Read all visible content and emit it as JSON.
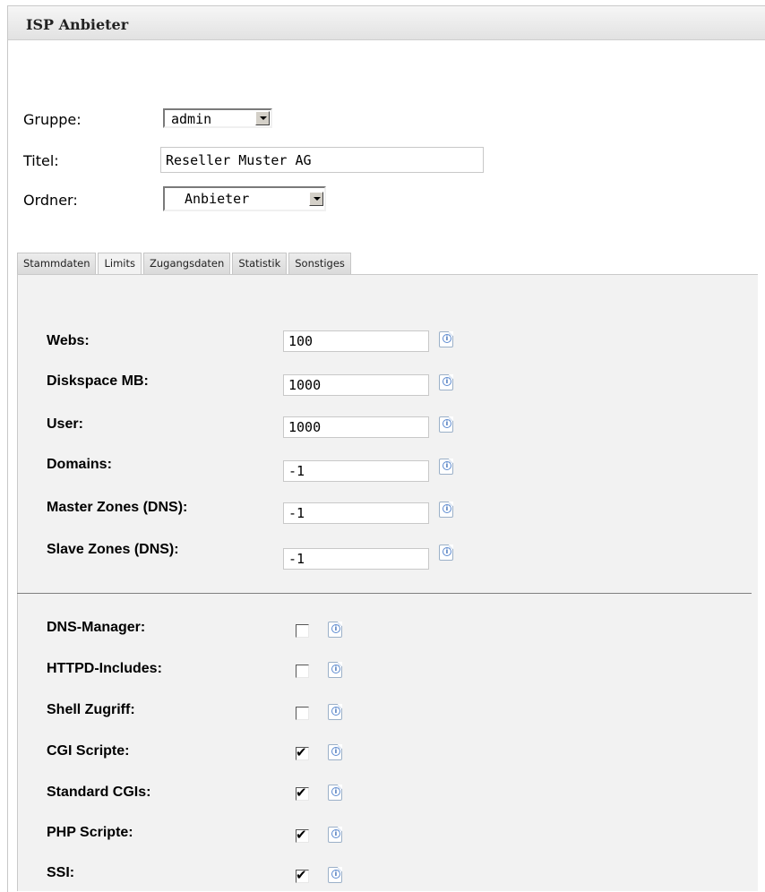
{
  "window": {
    "title": "ISP Anbieter"
  },
  "header": {
    "group_label": "Gruppe:",
    "group_value": "admin",
    "title_label": "Titel:",
    "title_value": "Reseller Muster AG",
    "folder_label": "Ordner:",
    "folder_value": "Anbieter"
  },
  "tabs": [
    {
      "label": "Stammdaten"
    },
    {
      "label": "Limits",
      "active": true
    },
    {
      "label": "Zugangsdaten"
    },
    {
      "label": "Statistik"
    },
    {
      "label": "Sonstiges"
    }
  ],
  "limits": [
    {
      "label": "Webs:",
      "value": "100"
    },
    {
      "label": "Diskspace MB:",
      "value": "1000"
    },
    {
      "label": "User:",
      "value": "1000"
    },
    {
      "label": "Domains:",
      "value": "-1"
    },
    {
      "label": "Master Zones (DNS):",
      "value": "-1"
    },
    {
      "label": "Slave Zones (DNS):",
      "value": "-1"
    }
  ],
  "options": [
    {
      "label": "DNS-Manager:",
      "checked": false
    },
    {
      "label": "HTTPD-Includes:",
      "checked": false
    },
    {
      "label": "Shell Zugriff:",
      "checked": false
    },
    {
      "label": "CGI Scripte:",
      "checked": true
    },
    {
      "label": "Standard CGIs:",
      "checked": true
    },
    {
      "label": "PHP Scripte:",
      "checked": true
    },
    {
      "label": "SSI:",
      "checked": true
    }
  ],
  "icons": {
    "info": "info-icon",
    "dropdown": "chevron-down-icon"
  }
}
